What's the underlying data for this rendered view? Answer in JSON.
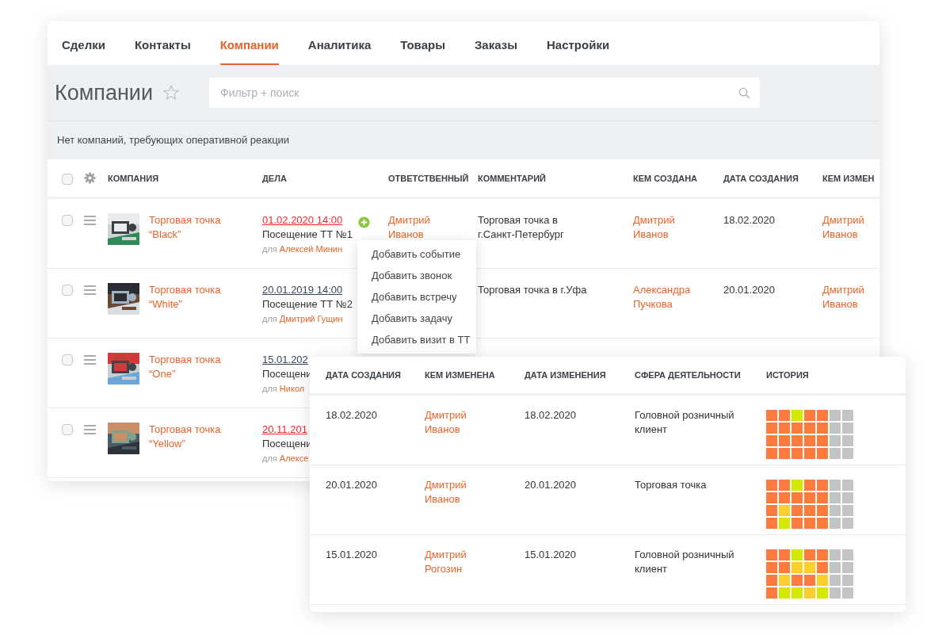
{
  "tabs": [
    {
      "label": "Сделки",
      "selected": false
    },
    {
      "label": "Контакты",
      "selected": false
    },
    {
      "label": "Компании",
      "selected": true
    },
    {
      "label": "Аналитика",
      "selected": false
    },
    {
      "label": "Товары",
      "selected": false
    },
    {
      "label": "Заказы",
      "selected": false
    },
    {
      "label": "Настройки",
      "selected": false
    }
  ],
  "page_title": "Компании",
  "favorite": false,
  "search": {
    "placeholder": "Фильтр + поиск"
  },
  "notice": "Нет компаний, требующих оперативной реакции",
  "table": {
    "all_checked": false,
    "columns": [
      "КОМПАНИЯ",
      "ДЕЛА",
      "ОТВЕТСТВЕННЫЙ",
      "КОММЕНТАРИЙ",
      "КЕМ СОЗДАНА",
      "ДАТА СОЗДАНИЯ",
      "КЕМ ИЗМЕН"
    ],
    "rows": [
      {
        "checked": false,
        "company": [
          "Торговая точка",
          "“Black”"
        ],
        "task_date": "01.02.2020 14:00",
        "overdue": true,
        "task": "Посещение ТТ №1",
        "for_label": "для",
        "for_person": "Алексей Минин",
        "add_button": true,
        "responsible": [
          "Дмитрий",
          "Иванов"
        ],
        "comment": [
          "Торговая точка в",
          "г.Санкт-Петербург"
        ],
        "created_by": [
          "Дмитрий",
          "Иванов"
        ],
        "created": "18.02.2020",
        "changed_by": [
          "Дмитрий",
          "Иванов"
        ]
      },
      {
        "checked": false,
        "company": [
          "Торговая точка",
          "“White”"
        ],
        "task_date": "20.01.2019 14:00",
        "overdue": false,
        "task": "Посещение ТТ №2",
        "for_label": "для",
        "for_person": "Дмитрий Гущин",
        "add_button": false,
        "comment": [
          "Торговая точка в г.Уфа"
        ],
        "created_by": [
          "Александра",
          "Пучкова"
        ],
        "created": "20.01.2020",
        "changed_by": [
          "Дмитрий",
          "Иванов"
        ]
      },
      {
        "checked": false,
        "company": [
          "Торговая точка",
          "“One”"
        ],
        "task_date": "15.01.202",
        "overdue": false,
        "task": "Посещени",
        "for_label": "для",
        "for_person": "Никол",
        "add_button": false
      },
      {
        "checked": false,
        "company": [
          "Торговая точка",
          "“Yellow”"
        ],
        "task_date": "20.11.201",
        "overdue": true,
        "task": "Посещени",
        "for_label": "для",
        "for_person": "Алексе",
        "add_button": false
      }
    ]
  },
  "add_menu": [
    "Добавить событие",
    "Добавить звонок",
    "Добавить встречу",
    "Добавить задачу",
    "Добавить визит в ТТ"
  ],
  "detail": {
    "columns": [
      "ДАТА СОЗДАНИЯ",
      "КЕМ ИЗМЕНЕНА",
      "ДАТА ИЗМЕНЕНИЯ",
      "СФЕРА ДЕЯТЕЛЬНОСТИ",
      "ИСТОРИЯ"
    ],
    "rows": [
      {
        "created": "18.02.2020",
        "changed_by": [
          "Дмитрий",
          "Иванов"
        ],
        "changed": "18.02.2020",
        "sphere": "Головной розничный клиент",
        "history": [
          [
            {
              "color": "#ff7a3d"
            },
            {
              "color": "#ff7a3d"
            },
            {
              "color": "#d4e800"
            },
            {
              "color": "#ff7a3d"
            },
            {
              "color": "#ff7a3d"
            },
            {
              "color": "#c4c4c4"
            },
            {
              "color": "#c4c4c4"
            }
          ],
          [
            {
              "color": "#ff7a3d"
            },
            {
              "color": "#ff7a3d"
            },
            {
              "color": "#ff7a3d"
            },
            {
              "color": "#ff7a3d"
            },
            {
              "color": "#ff7a3d"
            },
            {
              "color": "#c4c4c4"
            },
            {
              "color": "#c4c4c4"
            }
          ],
          [
            {
              "color": "#ff7a3d"
            },
            {
              "color": "#ff7a3d"
            },
            {
              "color": "#ff7a3d"
            },
            {
              "color": "#ff7a3d"
            },
            {
              "color": "#ff7a3d"
            },
            {
              "color": "#c4c4c4"
            },
            {
              "color": "#c4c4c4"
            }
          ],
          [
            {
              "color": "#ff7a3d"
            },
            {
              "color": "#ff7a3d"
            },
            {
              "color": "#ff7a3d"
            },
            {
              "color": "#ff7a3d"
            },
            {
              "color": "#ff7a3d"
            },
            {
              "color": "#c4c4c4"
            },
            {
              "color": "#c4c4c4"
            }
          ]
        ]
      },
      {
        "created": "20.01.2020",
        "changed_by": [
          "Дмитрий",
          "Иванов"
        ],
        "changed": "20.01.2020",
        "sphere": "Торговая точка",
        "history": [
          [
            {
              "color": "#ff7a3d"
            },
            {
              "color": "#ff7a3d"
            },
            {
              "color": "#d4e800"
            },
            {
              "color": "#ff7a3d"
            },
            {
              "color": "#ff7a3d"
            },
            {
              "color": "#c4c4c4"
            },
            {
              "color": "#c4c4c4"
            }
          ],
          [
            {
              "color": "#ff7a3d"
            },
            {
              "color": "#ff7a3d"
            },
            {
              "color": "#ff7a3d"
            },
            {
              "color": "#ff7a3d"
            },
            {
              "color": "#ff7a3d"
            },
            {
              "color": "#c4c4c4"
            },
            {
              "color": "#c4c4c4"
            }
          ],
          [
            {
              "color": "#ff7a3d"
            },
            {
              "color": "#fccf2c"
            },
            {
              "color": "#ff7a3d"
            },
            {
              "color": "#ff7a3d"
            },
            {
              "color": "#ff7a3d"
            },
            {
              "color": "#c4c4c4"
            },
            {
              "color": "#c4c4c4"
            }
          ],
          [
            {
              "color": "#ff7a3d"
            },
            {
              "color": "#d4e800"
            },
            {
              "color": "#ff7a3d"
            },
            {
              "color": "#ff7a3d"
            },
            {
              "color": "#ff7a3d"
            },
            {
              "color": "#c4c4c4"
            },
            {
              "color": "#c4c4c4"
            }
          ]
        ]
      },
      {
        "created": "15.01.2020",
        "changed_by": [
          "Дмитрий",
          "Рогозин"
        ],
        "changed": "15.01.2020",
        "sphere": "Головной розничный клиент",
        "history": [
          [
            {
              "color": "#ff7a3d"
            },
            {
              "color": "#ff7a3d"
            },
            {
              "color": "#d4e800"
            },
            {
              "color": "#ff7a3d"
            },
            {
              "color": "#ff7a3d"
            },
            {
              "color": "#c4c4c4"
            },
            {
              "color": "#c4c4c4"
            }
          ],
          [
            {
              "color": "#ff7a3d"
            },
            {
              "color": "#ff7a3d"
            },
            {
              "color": "#fccf2c"
            },
            {
              "color": "#fccf2c"
            },
            {
              "color": "#ff7a3d"
            },
            {
              "color": "#c4c4c4"
            },
            {
              "color": "#c4c4c4"
            }
          ],
          [
            {
              "color": "#ff7a3d"
            },
            {
              "color": "#fccf2c"
            },
            {
              "color": "#ff7a3d"
            },
            {
              "color": "#ff7a3d"
            },
            {
              "color": "#fccf2c"
            },
            {
              "color": "#c4c4c4"
            },
            {
              "color": "#c4c4c4"
            }
          ],
          [
            {
              "color": "#ff7a3d"
            },
            {
              "color": "#d4e800"
            },
            {
              "color": "#d4e800"
            },
            {
              "color": "#fccf2c"
            },
            {
              "color": "#d4e800"
            },
            {
              "color": "#c4c4c4"
            },
            {
              "color": "#c4c4c4"
            }
          ]
        ]
      }
    ]
  }
}
